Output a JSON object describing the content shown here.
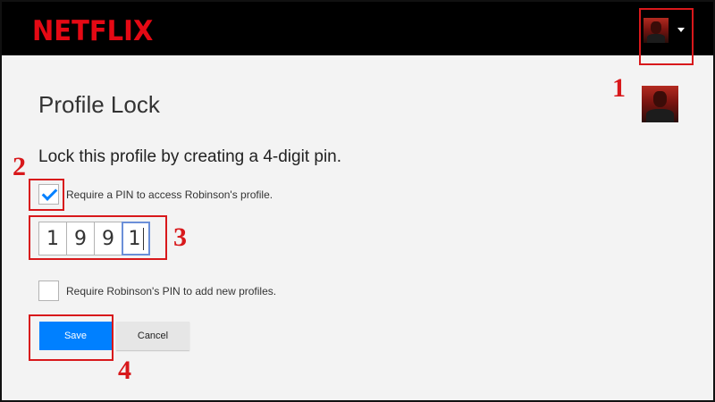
{
  "header": {
    "logo_text": "NETFLIX",
    "account_menu": {
      "avatar_icon": "profile-avatar-icon",
      "caret_icon": "caret-down-icon"
    }
  },
  "page": {
    "title": "Profile Lock",
    "subtitle": "Lock this profile by creating a 4-digit pin."
  },
  "require_pin": {
    "checked": true,
    "label": "Require a PIN to access Robinson's profile."
  },
  "pin": {
    "digits": [
      "1",
      "9",
      "9",
      "1"
    ]
  },
  "require_new_profiles": {
    "checked": false,
    "label": "Require Robinson's PIN to add new profiles."
  },
  "buttons": {
    "save_label": "Save",
    "cancel_label": "Cancel"
  },
  "annotations": {
    "n1": "1",
    "n2": "2",
    "n3": "3",
    "n4": "4"
  },
  "colors": {
    "brand_red": "#e50914",
    "header_bg": "#000000",
    "page_bg": "#f3f3f3",
    "primary_blue": "#0080ff",
    "annotation_red": "#d8181b"
  }
}
